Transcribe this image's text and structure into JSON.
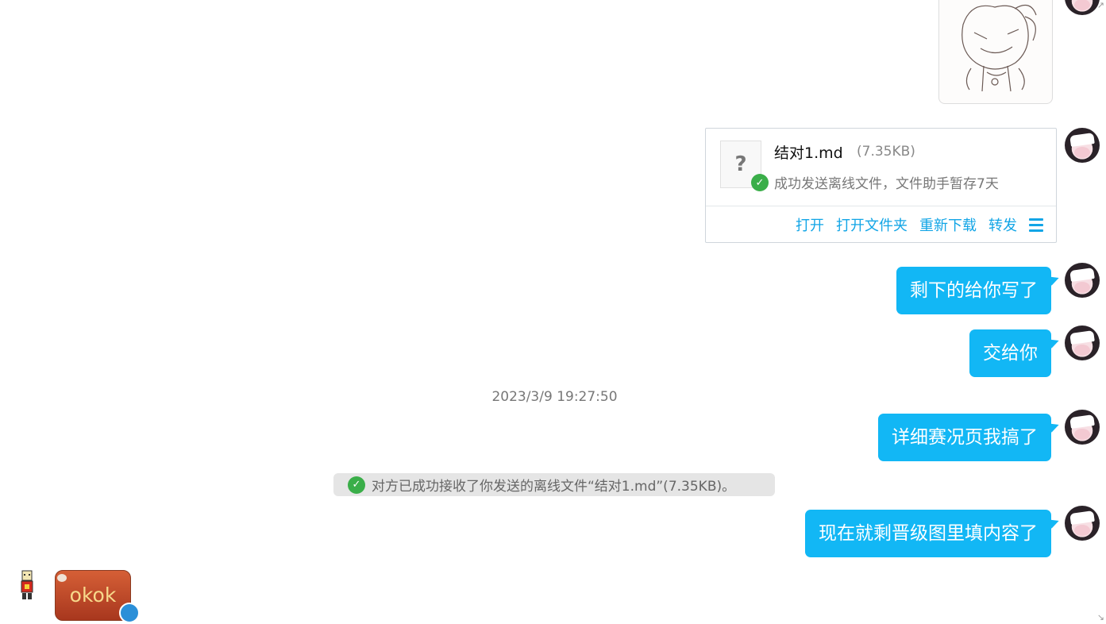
{
  "chat": {
    "file_transfer": {
      "file_name": "结对1.md",
      "file_size": "(7.35KB)",
      "status": "成功发送离线文件，文件助手暂存7天",
      "icon_glyph": "?",
      "actions": [
        "打开",
        "打开文件夹",
        "重新下载",
        "转发"
      ]
    },
    "messages_sent_group1": [
      {
        "text": "剩下的给你写了"
      },
      {
        "text": "交给你"
      }
    ],
    "timestamp": "2023/3/9 19:27:50",
    "messages_sent_group2": [
      {
        "text": "详细赛况页我搞了"
      }
    ],
    "system_notice": "对方已成功接收了你发送的离线文件“结对1.md”(7.35KB)。",
    "messages_sent_group3": [
      {
        "text": "现在就剩晋级图里填内容了"
      }
    ],
    "received_sticker_text": "okok"
  },
  "colors": {
    "bubble": "#12b7f5",
    "action_link": "#12a5e6",
    "success": "#3aae49",
    "notice_bg": "#e5e5e5"
  },
  "icons": {
    "file_unknown": "question-file-icon",
    "success": "check-circle-icon",
    "more": "menu-icon"
  }
}
